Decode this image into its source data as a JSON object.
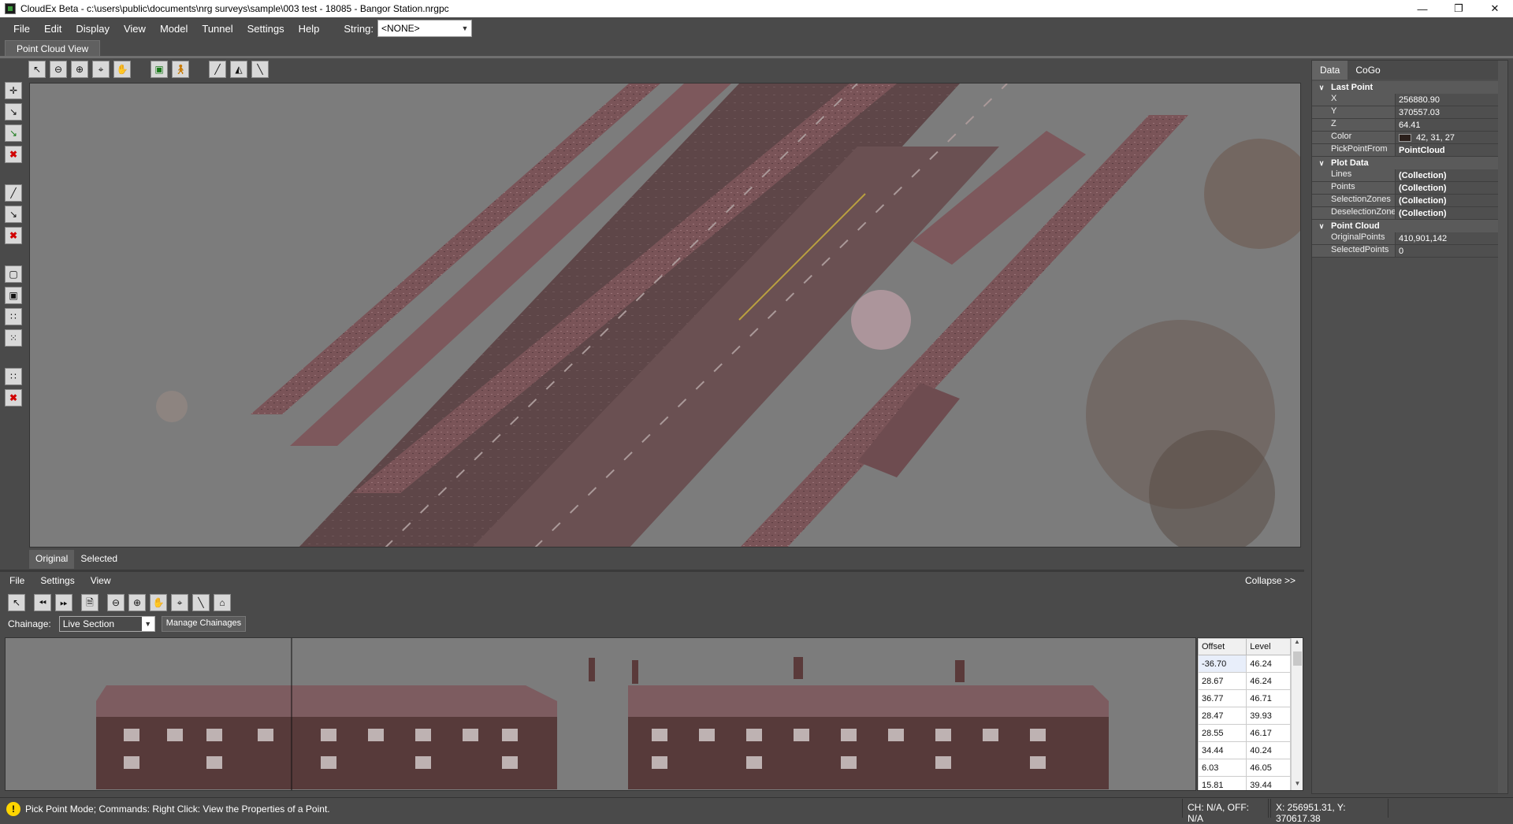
{
  "window": {
    "title": "CloudEx Beta - c:\\users\\public\\documents\\nrg surveys\\sample\\003 test - 18085 - Bangor Station.nrgpc"
  },
  "menu": {
    "file": "File",
    "edit": "Edit",
    "display": "Display",
    "view": "View",
    "model": "Model",
    "tunnel": "Tunnel",
    "settings": "Settings",
    "help": "Help",
    "string_label": "String:",
    "string_value": "<NONE>"
  },
  "doc_tab": "Point Cloud View",
  "view_tabs": {
    "original": "Original",
    "selected": "Selected"
  },
  "section": {
    "menu": {
      "file": "File",
      "settings": "Settings",
      "view": "View"
    },
    "collapse": "Collapse >>",
    "chainage_label": "Chainage:",
    "chainage_value": "Live Section",
    "manage_button": "Manage Chainages",
    "grid": {
      "headers": [
        "Offset",
        "Level"
      ],
      "rows": [
        [
          "-36.70",
          "46.24"
        ],
        [
          "28.67",
          "46.24"
        ],
        [
          "36.77",
          "46.71"
        ],
        [
          "28.47",
          "39.93"
        ],
        [
          "28.55",
          "46.17"
        ],
        [
          "34.44",
          "40.24"
        ],
        [
          "6.03",
          "46.05"
        ],
        [
          "15.81",
          "39.44"
        ]
      ]
    }
  },
  "right_panel": {
    "tabs": {
      "data": "Data",
      "cogo": "CoGo"
    },
    "last_point": {
      "header": "Last Point",
      "x_k": "X",
      "x": "256880.90",
      "y_k": "Y",
      "y": "370557.03",
      "z_k": "Z",
      "z": "64.41",
      "color_k": "Color",
      "color": "42, 31, 27",
      "pick_k": "PickPointFrom",
      "pick": "PointCloud"
    },
    "plot_data": {
      "header": "Plot Data",
      "lines_k": "Lines",
      "lines": "(Collection)",
      "points_k": "Points",
      "points": "(Collection)",
      "selz_k": "SelectionZones",
      "selz": "(Collection)",
      "deselz_k": "DeselectionZones",
      "deselz": "(Collection)"
    },
    "point_cloud": {
      "header": "Point Cloud",
      "orig_k": "OriginalPoints",
      "orig": "410,901,142",
      "sel_k": "SelectedPoints",
      "sel": "0"
    }
  },
  "status": {
    "message": "Pick Point Mode; Commands: Right Click: View the Properties of a Point.",
    "ch_off": "CH: N/A, OFF: N/A",
    "coords": "X: 256951.31, Y: 370617.38"
  }
}
